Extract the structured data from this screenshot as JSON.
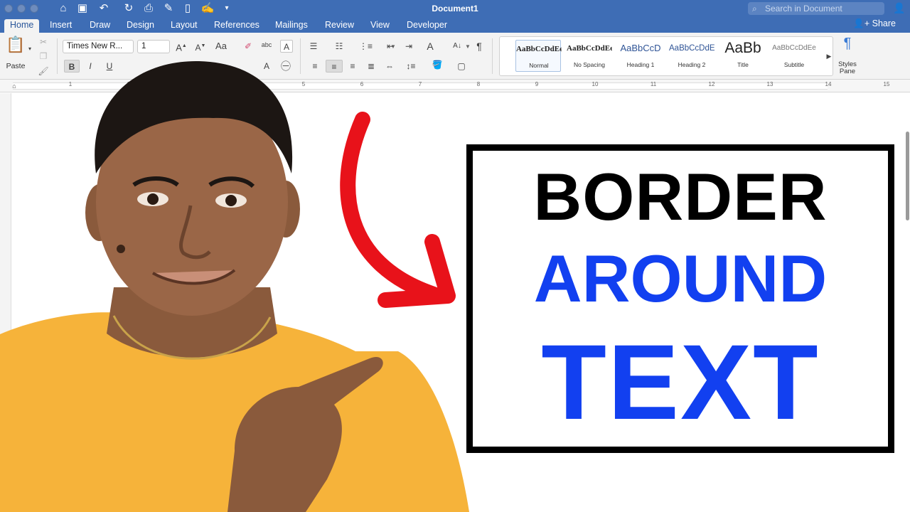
{
  "window": {
    "title": "Document1",
    "search_placeholder": "Search in Document",
    "share_label": "Share"
  },
  "tabs": [
    "Home",
    "Insert",
    "Draw",
    "Design",
    "Layout",
    "References",
    "Mailings",
    "Review",
    "View",
    "Developer"
  ],
  "ribbon": {
    "paste_label": "Paste",
    "font_name": "Times New R...",
    "font_size": "1",
    "bold": "B",
    "italic": "I",
    "underline": "U",
    "styles_pane_label": "Styles\nPane",
    "styles": [
      {
        "sample": "AaBbCcDdEe",
        "name": "Normal"
      },
      {
        "sample": "AaBbCcDdEe",
        "name": "No Spacing"
      },
      {
        "sample": "AaBbCcD",
        "name": "Heading 1"
      },
      {
        "sample": "AaBbCcDdE",
        "name": "Heading 2"
      },
      {
        "sample": "AaBb",
        "name": "Title"
      },
      {
        "sample": "AaBbCcDdEe",
        "name": "Subtitle"
      }
    ]
  },
  "ruler": {
    "numbers": [
      "1",
      "2",
      "3",
      "4",
      "5",
      "6",
      "7",
      "8",
      "9",
      "10",
      "11",
      "12",
      "13",
      "14",
      "15"
    ]
  },
  "document": {
    "line1": "BORDER",
    "line2": "AROUND",
    "line3": "TEXT"
  },
  "colors": {
    "titlebar": "#3e6db5",
    "accent_blue": "#1240f0",
    "arrow_red": "#e8121a",
    "shirt": "#f6b33a"
  }
}
